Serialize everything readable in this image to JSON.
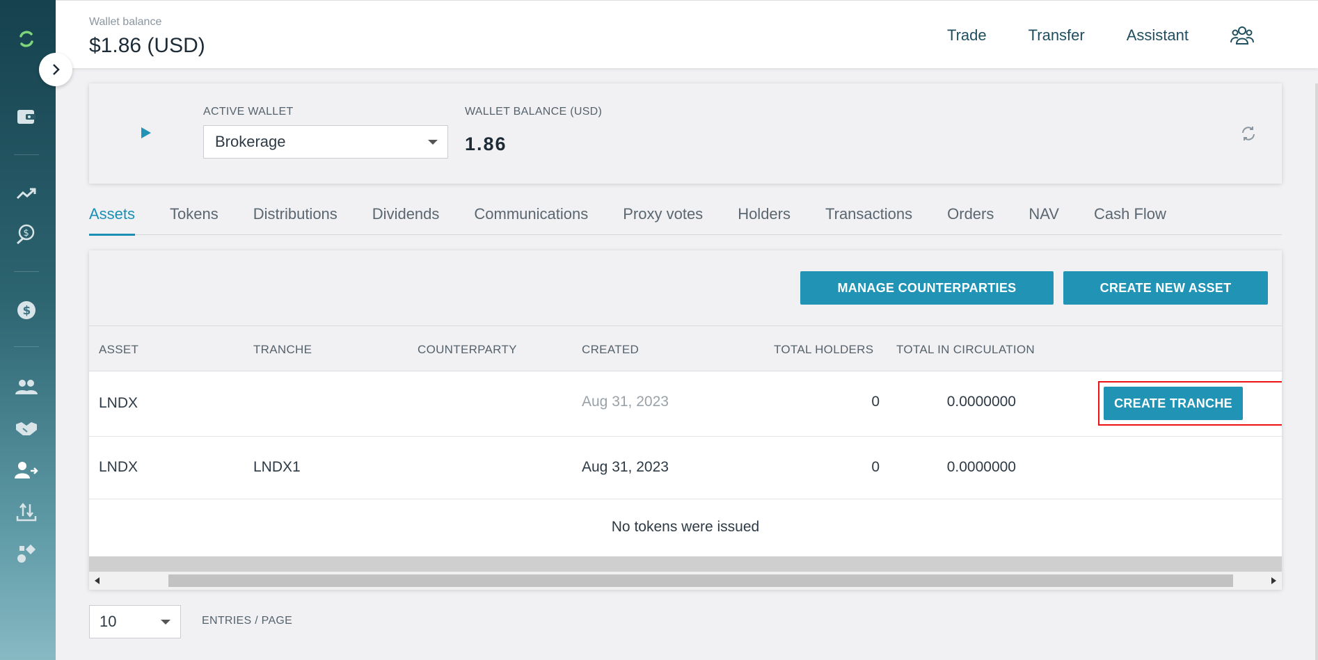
{
  "header": {
    "wallet_balance_label": "Wallet balance",
    "wallet_balance_value": "$1.86 (USD)",
    "nav": [
      "Trade",
      "Transfer",
      "Assistant"
    ]
  },
  "wallet": {
    "active_wallet_label": "ACTIVE WALLET",
    "active_wallet_value": "Brokerage",
    "balance_label": "WALLET BALANCE (USD)",
    "balance_value": "1.86"
  },
  "tabs": [
    "Assets",
    "Tokens",
    "Distributions",
    "Dividends",
    "Communications",
    "Proxy votes",
    "Holders",
    "Transactions",
    "Orders",
    "NAV",
    "Cash Flow"
  ],
  "active_tab": "Assets",
  "actions": {
    "manage": "MANAGE COUNTERPARTIES",
    "create_asset": "CREATE NEW ASSET"
  },
  "table": {
    "headers": [
      "ASSET",
      "TRANCHE",
      "COUNTERPARTY",
      "CREATED",
      "TOTAL HOLDERS",
      "TOTAL IN CIRCULATION"
    ],
    "rows": [
      {
        "asset": "LNDX",
        "tranche": "",
        "counterparty": "",
        "created": "Aug 31, 2023",
        "holders": "0",
        "circulation": "0.0000000",
        "action": "CREATE TRANCHE"
      },
      {
        "asset": "LNDX",
        "tranche": "LNDX1",
        "counterparty": "",
        "created": "Aug 31, 2023",
        "holders": "0",
        "circulation": "0.0000000"
      }
    ],
    "empty_message": "No tokens were issued"
  },
  "pagination": {
    "page_size": "10",
    "label": "ENTRIES / PAGE"
  },
  "colors": {
    "accent": "#2194b6",
    "highlight": "#ee1111"
  }
}
